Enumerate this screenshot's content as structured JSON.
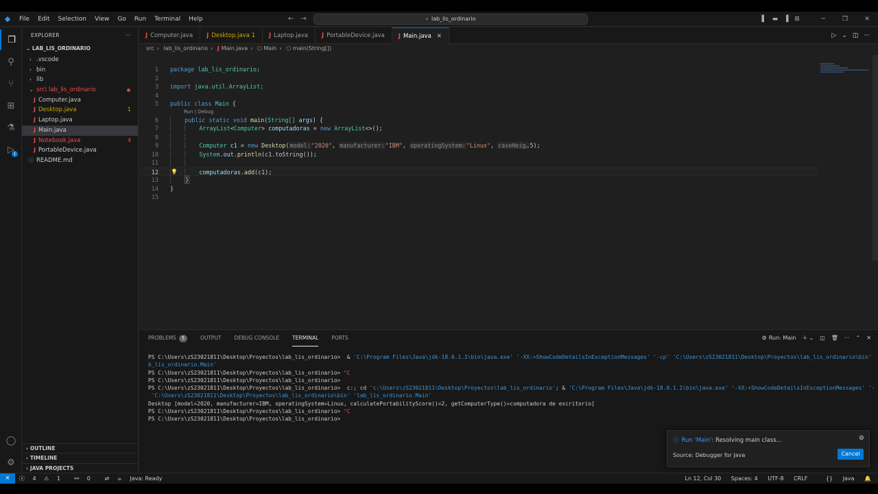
{
  "titlebar": {
    "menu": [
      "File",
      "Edit",
      "Selection",
      "View",
      "Go",
      "Run",
      "Terminal",
      "Help"
    ],
    "search": "lab_lis_ordinario"
  },
  "sidebar": {
    "title": "EXPLORER",
    "root": "LAB_LIS_ORDINARIO",
    "items": [
      {
        "label": ".vscode"
      },
      {
        "label": "bin"
      },
      {
        "label": "lib"
      },
      {
        "label": "src\\ lab_lis_ordinario"
      },
      {
        "label": "Computer.java"
      },
      {
        "label": "Desktop.java",
        "count": "1"
      },
      {
        "label": "Laptop.java"
      },
      {
        "label": "Main.java"
      },
      {
        "label": "Notebook.java",
        "count": "4"
      },
      {
        "label": "PortableDevice.java"
      },
      {
        "label": "README.md"
      }
    ],
    "sections": [
      "OUTLINE",
      "TIMELINE",
      "JAVA PROJECTS"
    ]
  },
  "tabs": [
    {
      "label": "Computer.java"
    },
    {
      "label": "Desktop.java 1"
    },
    {
      "label": "Laptop.java"
    },
    {
      "label": "PortableDevice.java"
    },
    {
      "label": "Main.java"
    }
  ],
  "breadcrumb": [
    "src",
    "lab_lis_ordinario",
    "Main.java",
    "Main",
    "main(String[])"
  ],
  "editor": {
    "code_lens": "Run | Debug",
    "line_numbers": [
      "1",
      "2",
      "3",
      "4",
      "5",
      "6",
      "7",
      "8",
      "9",
      "10",
      "11",
      "12",
      "13",
      "14",
      "15"
    ],
    "tokens": {
      "package": "package",
      "pkg_name": "lab_lis_ordinario;",
      "import": "import",
      "import_path": "java.util.ArrayList;",
      "public": "public",
      "class": "class",
      "class_name": "Main",
      "brace_open": "{",
      "static": "static",
      "void": "void",
      "main": "main",
      "params_open": "(",
      "string_arr": "String[]",
      "args": "args",
      "params_close": ") {",
      "arraylist": "ArrayList",
      "lt": "<",
      "computer": "Computer",
      "gt": ">",
      "computadoras": "computadoras",
      "eq": "=",
      "new": "new",
      "diamond": "<>();",
      "c1": "c1",
      "desktop": "Desktop",
      "paren_open": "(",
      "hint_model": "model:",
      "val_model": "\"2020\"",
      "comma": ",",
      "hint_manufacturer": "manufacturer:",
      "val_manufacturer": "\"IBM\"",
      "hint_os": "operatingSystem:",
      "val_os": "\"Linux\"",
      "hint_case": "caseHeig…",
      "val_case": "5",
      "close_semi": ");",
      "system": "System",
      "dot": ".",
      "out": "out",
      "println": "println",
      "tostring_call": "(c1.toString());",
      "computadoras_add": "computadoras.",
      "add": "add",
      "add_args": "(c1);",
      "brace_close": "}"
    }
  },
  "panel": {
    "tabs": [
      "PROBLEMS",
      "OUTPUT",
      "DEBUG CONSOLE",
      "TERMINAL",
      "PORTS"
    ],
    "problems_count": "5",
    "run_label": "Run: Main",
    "terminal": {
      "l1_prompt": "PS C:\\Users\\zS23021811\\Desktop\\Proyectos\\lab_lis_ordinario>  & ",
      "l1_cmd": "'C:\\Program Files\\Java\\jdk-18.0.1.1\\bin\\java.exe' '-XX:+ShowCodeDetailsInExceptionMessages' '-cp' 'C:\\Users\\zS23021811\\Desktop\\Proyectos\\lab_lis_ordinario\\bin' 'la",
      "l2": "b_lis_ordinario.Main'",
      "l3_prompt": "PS C:\\Users\\zS23021811\\Desktop\\Proyectos\\lab_lis_ordinario> ",
      "ctrl_c": "^C",
      "l4": "PS C:\\Users\\zS23021811\\Desktop\\Proyectos\\lab_lis_ordinario>",
      "l5_prompt": "PS C:\\Users\\zS23021811\\Desktop\\Proyectos\\lab_lis_ordinario>  c:; cd ",
      "l5_path": "'c:\\Users\\zS23021811\\Desktop\\Proyectos\\lab_lis_ordinario'",
      "l5_mid": "; & ",
      "l5_cmd": "'C:\\Program Files\\Java\\jdk-18.0.1.1\\bin\\java.exe' '-XX:+ShowCodeDetailsInExceptionMessages' '-cp'",
      "l6": " 'C:\\Users\\zS23021811\\Desktop\\Proyectos\\lab_lis_ordinario\\bin' 'lab_lis_ordinario.Main'",
      "l7": "Desktop [model=2020, manufacturer=IBM, operatingSystem=Linux, calculatePortabilityScore()=2, getComputerType()=computadora de escritorio]",
      "l8_prompt": "PS C:\\Users\\zS23021811\\Desktop\\Proyectos\\lab_lis_ordinario> ",
      "l9": "PS C:\\Users\\zS23021811\\Desktop\\Proyectos\\lab_lis_ordinario>"
    }
  },
  "notification": {
    "title_highlight": "Run 'Main'",
    "title_rest": ": Resolving main class...",
    "source": "Source: Debugger for Java",
    "cancel": "Cancel"
  },
  "statusbar": {
    "errors": "4",
    "warnings": "1",
    "ports": "0",
    "java_status": "Java: Ready",
    "position": "Ln 12, Col 30",
    "spaces": "Spaces: 4",
    "encoding": "UTF-8",
    "eol": "CRLF",
    "language": "Java"
  },
  "colors": {
    "accent": "#0078d4",
    "error": "#f14c4c",
    "warning": "#cca700",
    "keyword": "#569cd6",
    "type": "#4ec9b0",
    "string": "#ce9178"
  }
}
